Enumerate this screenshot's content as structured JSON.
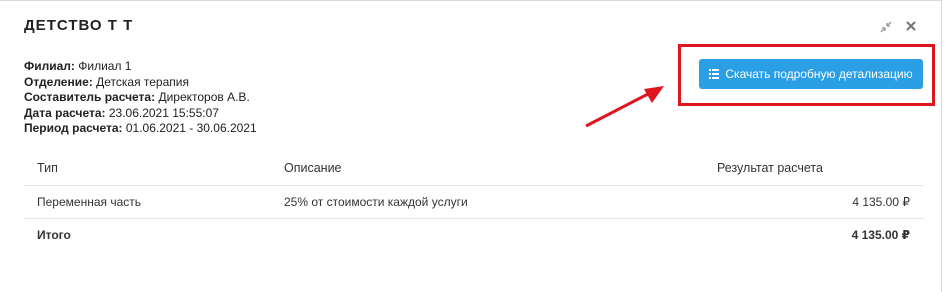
{
  "modal": {
    "title": "ДЕТСТВО Т Т"
  },
  "info": [
    {
      "label": "Филиал:",
      "value": " Филиал 1"
    },
    {
      "label": "Отделение:",
      "value": " Детская терапия"
    },
    {
      "label": "Составитель расчета:",
      "value": " Директоров А.В."
    },
    {
      "label": "Дата расчета:",
      "value": " 23.06.2021 15:55:07"
    },
    {
      "label": "Период расчета:",
      "value": " 01.06.2021 - 30.06.2021"
    }
  ],
  "download_button": {
    "label": "Скачать подробную детализацию",
    "icon": "list-icon"
  },
  "table": {
    "headers": [
      "Тип",
      "Описание",
      "Результат расчета"
    ],
    "rows": [
      {
        "type": "Переменная часть",
        "description": "25% от стоимости каждой услуги",
        "result": "4 135.00 ₽"
      }
    ],
    "total": {
      "type": "Итого",
      "description": "",
      "result": "4 135.00 ₽"
    }
  },
  "colors": {
    "accent": "#2b9fe6",
    "annotation": "#e0141e"
  }
}
